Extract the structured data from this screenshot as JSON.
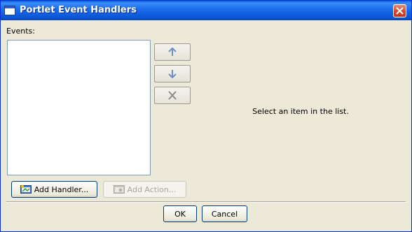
{
  "window": {
    "title": "Portlet Event Handlers"
  },
  "events": {
    "label": "Events:",
    "items": []
  },
  "detail": {
    "placeholder": "Select an item in the list."
  },
  "buttons": {
    "add_handler": "Add Handler...",
    "add_action": "Add Action...",
    "ok": "OK",
    "cancel": "Cancel"
  },
  "side_buttons": [
    "arrow-up-icon",
    "arrow-down-icon",
    "delete-x-icon"
  ],
  "colors": {
    "titlebar": "#0a56d6",
    "face": "#ece9d8",
    "close": "#d3452a",
    "arrow": "#6b8fc9"
  }
}
